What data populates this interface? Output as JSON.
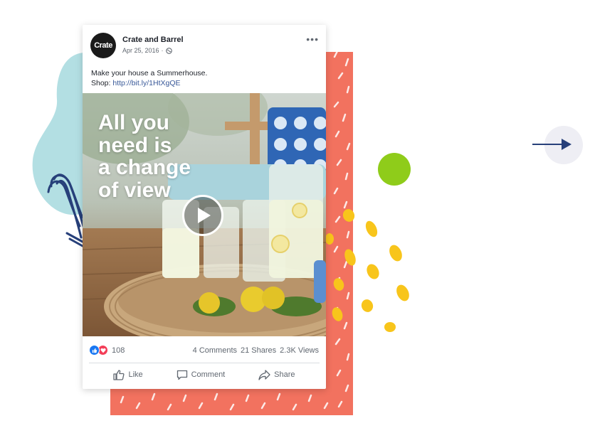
{
  "post": {
    "page_name": "Crate and Barrel",
    "avatar_text": "Crate",
    "date": "Apr 25, 2016",
    "separator": "·",
    "privacy_icon": "globe-icon",
    "more_label": "•••",
    "caption_line1": "Make your house a Summerhouse.",
    "caption_shop_label": "Shop:",
    "caption_link": "http://bit.ly/1HtXgQE"
  },
  "video": {
    "overlay_text": "All you\nneed is\na change\nof view",
    "play_icon": "play-icon"
  },
  "stats": {
    "reactions_count": "108",
    "comments": "4 Comments",
    "shares": "21 Shares",
    "views": "2.3K Views",
    "reaction_icons": [
      "like-reaction-icon",
      "love-reaction-icon"
    ]
  },
  "actions": {
    "like": "Like",
    "comment": "Comment",
    "share": "Share"
  },
  "colors": {
    "coral": "#f2725f",
    "teal_blob": "#b3dfe3",
    "navy": "#27407a",
    "green_dot": "#8fcc1a",
    "yellow": "#f8c51b",
    "link": "#385898"
  },
  "nav": {
    "next_icon": "arrow-right-icon"
  }
}
